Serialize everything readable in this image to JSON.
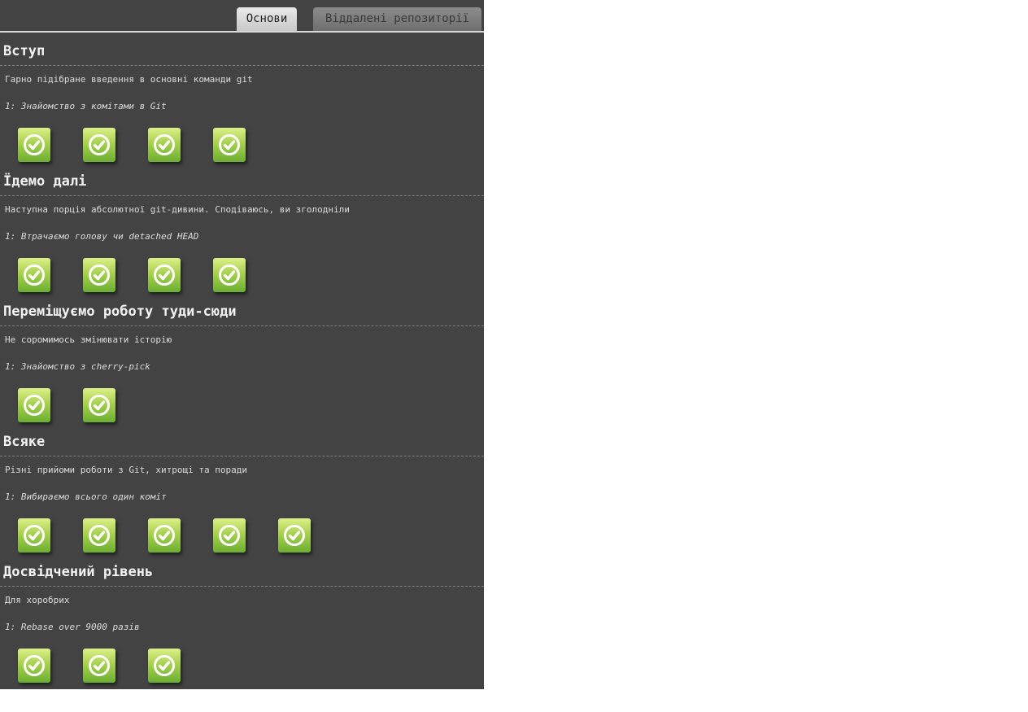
{
  "tabs": [
    {
      "label": "Основи",
      "active": true
    },
    {
      "label": "Віддалені репозиторії",
      "active": false
    }
  ],
  "colors": {
    "panel_bg": "#434343",
    "level_complete_green": "#7bbb38",
    "check_icon": "#ffffff"
  },
  "sequences": [
    {
      "title": "Вступ",
      "about": "Гарно підібране введення в основні команди git",
      "current_level": "1: Знайомство з комітами в Git",
      "levels": [
        {
          "status": "complete",
          "icon": "check-circle-icon"
        },
        {
          "status": "complete",
          "icon": "check-circle-icon"
        },
        {
          "status": "complete",
          "icon": "check-circle-icon"
        },
        {
          "status": "complete",
          "icon": "check-circle-icon"
        }
      ]
    },
    {
      "title": "Їдемо далі",
      "about": "Наступна порція абсолютної git-дивини. Сподіваюсь, ви зголодніли",
      "current_level": "1: Втрачаємо голову чи detached HEAD",
      "levels": [
        {
          "status": "complete",
          "icon": "check-circle-icon"
        },
        {
          "status": "complete",
          "icon": "check-circle-icon"
        },
        {
          "status": "complete",
          "icon": "check-circle-icon"
        },
        {
          "status": "complete",
          "icon": "check-circle-icon"
        }
      ]
    },
    {
      "title": "Переміщуємо роботу туди-сюди",
      "about": "Не соромимось змінювати історію",
      "current_level": "1: Знайомство з cherry-pick",
      "levels": [
        {
          "status": "complete",
          "icon": "check-circle-icon"
        },
        {
          "status": "complete",
          "icon": "check-circle-icon"
        }
      ]
    },
    {
      "title": "Всяке",
      "about": "Різні прийоми роботи з Git, хитрощі та поради",
      "current_level": "1: Вибираємо всього один коміт",
      "levels": [
        {
          "status": "complete",
          "icon": "check-circle-icon"
        },
        {
          "status": "complete",
          "icon": "check-circle-icon"
        },
        {
          "status": "complete",
          "icon": "check-circle-icon"
        },
        {
          "status": "complete",
          "icon": "check-circle-icon"
        },
        {
          "status": "complete",
          "icon": "check-circle-icon"
        }
      ]
    },
    {
      "title": "Досвідчений рівень",
      "about": "Для хоробрих",
      "current_level": "1: Rebase over 9000 разів",
      "levels": [
        {
          "status": "complete",
          "icon": "check-circle-icon"
        },
        {
          "status": "complete",
          "icon": "check-circle-icon"
        },
        {
          "status": "complete",
          "icon": "check-circle-icon"
        }
      ]
    }
  ]
}
